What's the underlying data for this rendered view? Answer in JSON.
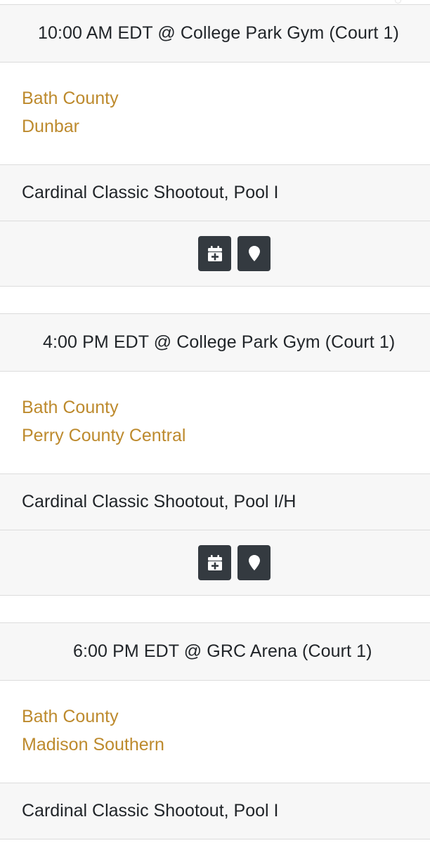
{
  "games": [
    {
      "header": "10:00 AM EDT @ College Park Gym (Court 1)",
      "team1": "Bath County",
      "team2": "Dunbar",
      "event": "Cardinal Classic Shootout, Pool I",
      "buttons": {
        "calendar_icon": "calendar-plus-icon",
        "map_icon": "map-marker-icon"
      }
    },
    {
      "header": "4:00 PM EDT @ College Park Gym (Court 1)",
      "team1": "Bath County",
      "team2": "Perry County Central",
      "event": "Cardinal Classic Shootout, Pool I/H",
      "buttons": {
        "calendar_icon": "calendar-plus-icon",
        "map_icon": "map-marker-icon"
      }
    },
    {
      "header": "6:00 PM EDT @ GRC Arena (Court 1)",
      "team1": "Bath County",
      "team2": "Madison Southern",
      "event": "Cardinal Classic Shootout, Pool I"
    }
  ],
  "colors": {
    "team_link": "#bd8a2d",
    "button_bg": "#343a40",
    "row_gray": "#f7f7f7",
    "border": "#dcdcdc"
  }
}
